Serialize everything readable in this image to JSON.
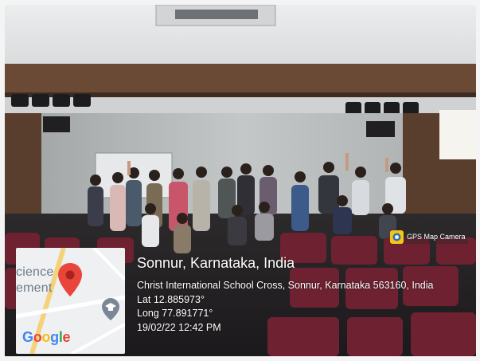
{
  "map": {
    "line_1": "cience",
    "line_2": "ement",
    "google_letters": [
      {
        "char": "G",
        "color": "#4285F4"
      },
      {
        "char": "o",
        "color": "#EA4335"
      },
      {
        "char": "o",
        "color": "#FBBC05"
      },
      {
        "char": "g",
        "color": "#4285F4"
      },
      {
        "char": "l",
        "color": "#34A853"
      },
      {
        "char": "e",
        "color": "#EA4335"
      }
    ],
    "pin_icon": "map-pin-icon",
    "poi_icon": "graduation-cap-icon"
  },
  "badge": {
    "label": "GPS Map Camera",
    "icon": "camera-icon"
  },
  "location": {
    "title": "Sonnur, Karnataka, India",
    "address": "Christ International School Cross, Sonnur, Karnataka 563160, India",
    "lat": "Lat 12.885973°",
    "long": "Long 77.891771°",
    "datetime": "19/02/22 12:42 PM"
  },
  "colors": {
    "pin": "#E8453C",
    "seat": "#6e2130",
    "wood": "#6b4a35",
    "wall": "#b9bcbd"
  }
}
